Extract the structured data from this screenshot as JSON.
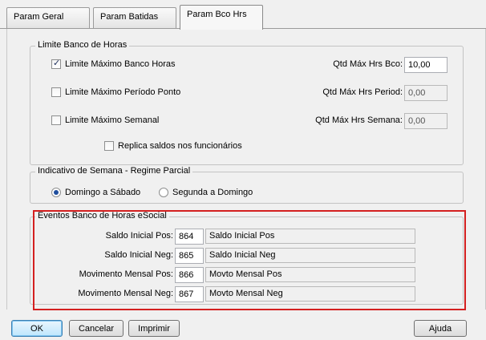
{
  "tabs": [
    {
      "label": "Param Geral"
    },
    {
      "label": "Param Batidas"
    },
    {
      "label": "Param Bco Hrs"
    }
  ],
  "limite": {
    "legend": "Limite Banco de Horas",
    "max_banco": {
      "label": "Limite Máximo Banco Horas",
      "checked": true,
      "qtd_label": "Qtd Máx Hrs Bco:",
      "qtd_value": "10,00"
    },
    "max_periodo": {
      "label": "Limite Máximo Período Ponto",
      "checked": false,
      "qtd_label": "Qtd Máx Hrs Period:",
      "qtd_value": "0,00"
    },
    "max_semanal": {
      "label": "Limite Máximo Semanal",
      "checked": false,
      "qtd_label": "Qtd Máx Hrs Semana:",
      "qtd_value": "0,00"
    },
    "replica": {
      "label": "Replica saldos nos funcionários",
      "checked": false
    }
  },
  "semana": {
    "legend": "Indicativo de Semana - Regime Parcial",
    "opt1": "Domingo a Sábado",
    "opt2": "Segunda a Domingo",
    "selected": "opt1"
  },
  "eventos": {
    "legend": "Eventos Banco de Horas eSocial",
    "rows": [
      {
        "label": "Saldo Inicial Pos:",
        "code": "864",
        "desc": "Saldo Inicial Pos"
      },
      {
        "label": "Saldo Inicial Neg:",
        "code": "865",
        "desc": "Saldo Inicial Neg"
      },
      {
        "label": "Movimento Mensal Pos:",
        "code": "866",
        "desc": "Movto Mensal Pos"
      },
      {
        "label": "Movimento Mensal Neg:",
        "code": "867",
        "desc": "Movto Mensal Neg"
      }
    ]
  },
  "buttons": {
    "ok": "OK",
    "cancel": "Cancelar",
    "print": "Imprimir",
    "help": "Ajuda"
  },
  "colors": {
    "highlight": "#d42020",
    "accent": "#3c7fb1"
  }
}
